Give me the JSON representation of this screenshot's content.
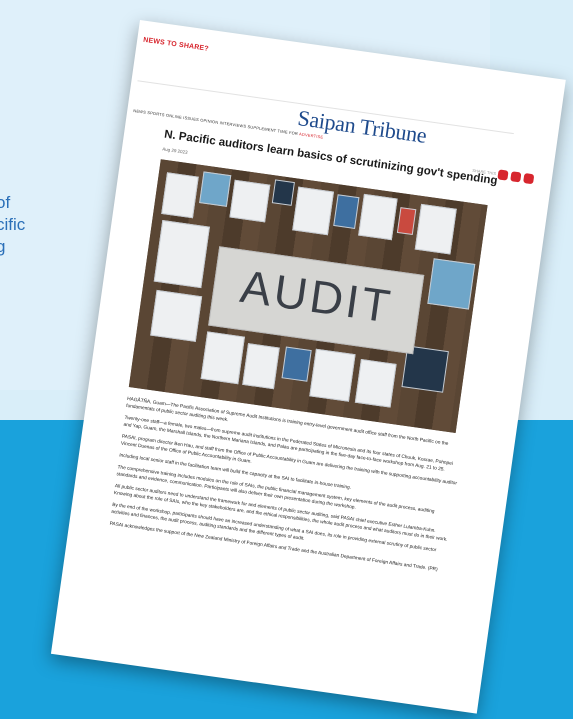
{
  "side_caption": [
    "of",
    "cific",
    "g"
  ],
  "article": {
    "kicker": "NEWS TO SHARE?",
    "brand": "Saipan Tribune",
    "nav": "NEWS   SPORTS   ONLINE   ISSUES   OPINION   INTERVIEWS   SUPPLEMENT   TIME FOR",
    "nav_highlight": "ADVERTISE",
    "share_label": "SHARE THIS",
    "headline": "N. Pacific auditors learn basics of scrutinizing gov't spending",
    "date": "Aug 29 2023",
    "image_word": "AUDIT",
    "paragraphs": [
      "HAGÅTÑA, Guam—The Pacific Association of Supreme Audit Institutions is training entry-level government audit office staff from the North Pacific on the fundamentals of public sector auditing this week.",
      "Twenty-one staff—a female, two males—from supreme audit institutions in the Federated States of Micronesia and its four states of Chuuk, Kosrae, Pohnpei and Yap, Guam, the Marshall Islands, the Northern Mariana Islands, and Palau are participating in the five-day face-to-face workshop from Aug. 21 to 25.",
      "PASAI, program director Ben Hau, and staff from the Office of Public Accountability in Guam are delivering the training with the supporting accountability auditor Vincent Duenas of the Office of Public Accountability in Guam.",
      "Including local senior staff in the facilitation team will build the capacity at the SAI to facilitate in-house training.",
      "The comprehensive training includes modules on the role of SAIs, the public financial management system, key elements of the audit process, auditing standards and evidence, communication. Participants will also deliver their own presentation during the workshop.",
      "All public sector auditors need to understand the framework for and elements of public sector auditing, said PASAI chief executive Esther Lulamba-Kuhn. Knowing about the role of SAIs, who the key stakeholders are, and the ethical responsibilities, the whole audit process and what auditors must do in their work.",
      "By the end of the workshop, participants should have an increased understanding of what a SAI does, its role in providing external scrutiny of public sector activities and finances, the audit process, auditing standards and the different types of audit.",
      "PASAI acknowledges the support of the New Zealand Ministry of Foreign Affairs and Trade and the Australian Department of Foreign Affairs and Trade. (PR)"
    ]
  }
}
